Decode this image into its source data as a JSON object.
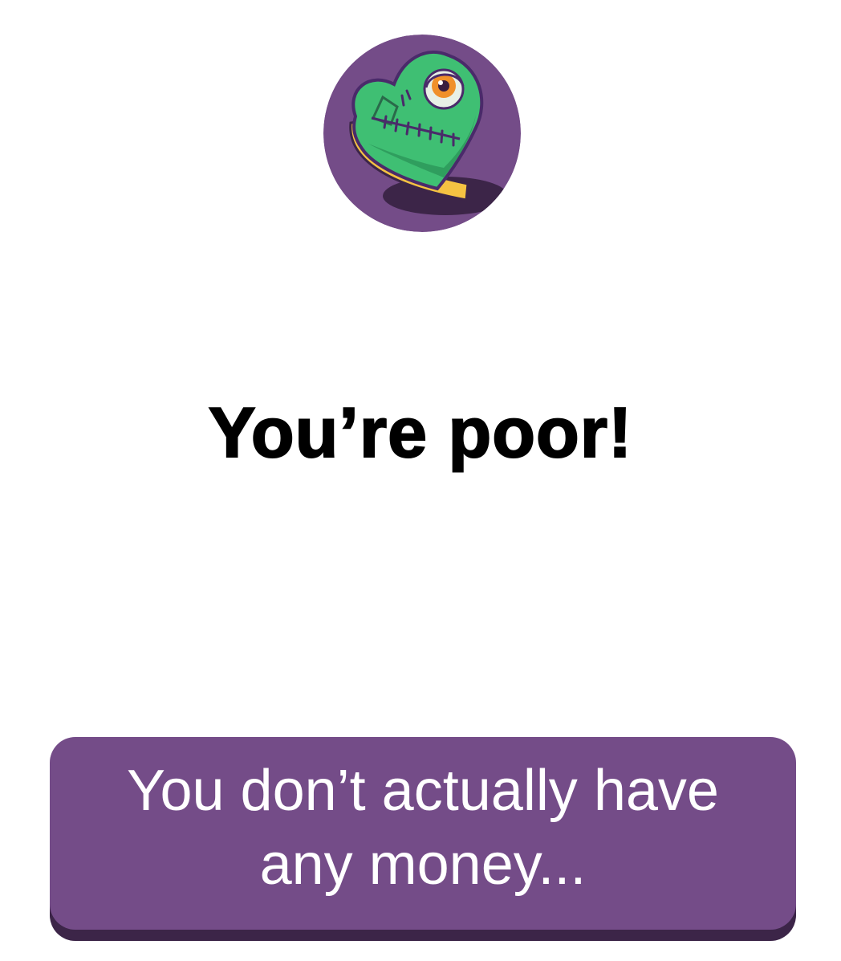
{
  "avatar": {
    "icon": "green-patched-heart-eye-icon",
    "background_color": "#744c88"
  },
  "title": "You’re poor!",
  "message": {
    "text": "You don’t actually have any money...",
    "background_color": "#744c88",
    "shadow_color": "#3c2548"
  }
}
